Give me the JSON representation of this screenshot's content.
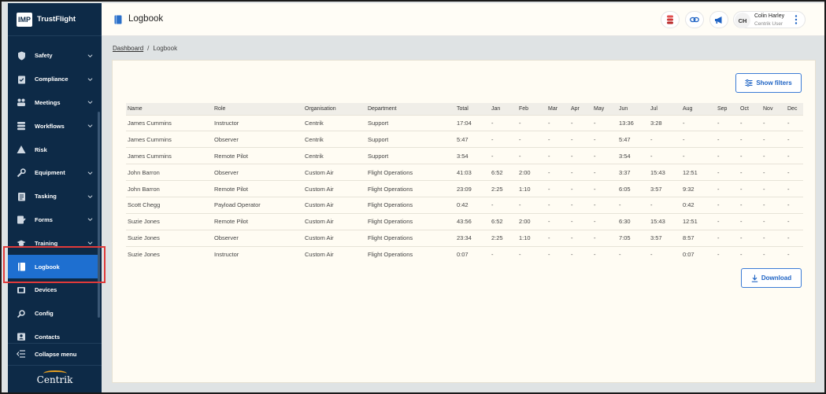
{
  "brand": {
    "logo": "IMP",
    "name": "TrustFlight"
  },
  "sidebar": {
    "items": [
      {
        "label": "Safety",
        "icon": "shield-icon",
        "chevron": true
      },
      {
        "label": "Compliance",
        "icon": "clipboard-icon",
        "chevron": true
      },
      {
        "label": "Meetings",
        "icon": "people-icon",
        "chevron": true
      },
      {
        "label": "Workflows",
        "icon": "layers-icon",
        "chevron": true
      },
      {
        "label": "Risk",
        "icon": "warning-icon",
        "chevron": false
      },
      {
        "label": "Equipment",
        "icon": "wrench-icon",
        "chevron": true
      },
      {
        "label": "Tasking",
        "icon": "tasks-icon",
        "chevron": true
      },
      {
        "label": "Forms",
        "icon": "forms-icon",
        "chevron": true
      },
      {
        "label": "Training",
        "icon": "graduation-cap-icon",
        "chevron": true
      },
      {
        "label": "Logbook",
        "icon": "book-icon",
        "chevron": false,
        "active": true
      },
      {
        "label": "Devices",
        "icon": "devices-icon",
        "chevron": false
      },
      {
        "label": "Config",
        "icon": "config-icon",
        "chevron": false
      },
      {
        "label": "Contacts",
        "icon": "contacts-icon",
        "chevron": false
      }
    ],
    "collapse_label": "Collapse menu",
    "footer_logo": "Centrik"
  },
  "header": {
    "title": "Logbook",
    "user_initials": "CH",
    "user_name": "Colin Harley",
    "user_role": "Centrik User"
  },
  "breadcrumb": {
    "parent": "Dashboard",
    "separator": "/",
    "current": "Logbook"
  },
  "toolbar": {
    "filters_label": "Show filters",
    "download_label": "Download"
  },
  "table": {
    "columns": [
      "Name",
      "Role",
      "Organisation",
      "Department",
      "Total",
      "Jan",
      "Feb",
      "Mar",
      "Apr",
      "May",
      "Jun",
      "Jul",
      "Aug",
      "Sep",
      "Oct",
      "Nov",
      "Dec"
    ],
    "rows": [
      [
        "James Cummins",
        "Instructor",
        "Centrik",
        "Support",
        "17:04",
        "-",
        "-",
        "-",
        "-",
        "-",
        "13:36",
        "3:28",
        "-",
        "-",
        "-",
        "-",
        "-"
      ],
      [
        "James Cummins",
        "Observer",
        "Centrik",
        "Support",
        "5:47",
        "-",
        "-",
        "-",
        "-",
        "-",
        "5:47",
        "-",
        "-",
        "-",
        "-",
        "-",
        "-"
      ],
      [
        "James Cummins",
        "Remote Pilot",
        "Centrik",
        "Support",
        "3:54",
        "-",
        "-",
        "-",
        "-",
        "-",
        "3:54",
        "-",
        "-",
        "-",
        "-",
        "-",
        "-"
      ],
      [
        "John Barron",
        "Observer",
        "Custom Air",
        "Flight Operations",
        "41:03",
        "6:52",
        "2:00",
        "-",
        "-",
        "-",
        "3:37",
        "15:43",
        "12:51",
        "-",
        "-",
        "-",
        "-"
      ],
      [
        "John Barron",
        "Remote Pilot",
        "Custom Air",
        "Flight Operations",
        "23:09",
        "2:25",
        "1:10",
        "-",
        "-",
        "-",
        "6:05",
        "3:57",
        "9:32",
        "-",
        "-",
        "-",
        "-"
      ],
      [
        "Scott Chegg",
        "Payload Operator",
        "Custom Air",
        "Flight Operations",
        "0:42",
        "-",
        "-",
        "-",
        "-",
        "-",
        "-",
        "-",
        "0:42",
        "-",
        "-",
        "-",
        "-"
      ],
      [
        "Suzie Jones",
        "Remote Pilot",
        "Custom Air",
        "Flight Operations",
        "43:56",
        "6:52",
        "2:00",
        "-",
        "-",
        "-",
        "6:30",
        "15:43",
        "12:51",
        "-",
        "-",
        "-",
        "-"
      ],
      [
        "Suzie Jones",
        "Observer",
        "Custom Air",
        "Flight Operations",
        "23:34",
        "2:25",
        "1:10",
        "-",
        "-",
        "-",
        "7:05",
        "3:57",
        "8:57",
        "-",
        "-",
        "-",
        "-"
      ],
      [
        "Suzie Jones",
        "Instructor",
        "Custom Air",
        "Flight Operations",
        "0:07",
        "-",
        "-",
        "-",
        "-",
        "-",
        "-",
        "-",
        "0:07",
        "-",
        "-",
        "-",
        "-"
      ]
    ]
  },
  "colors": {
    "sidebar": "#0d2a47",
    "active": "#1e6fd0",
    "accent": "#1e63c4",
    "highlight": "#e03a3a"
  }
}
